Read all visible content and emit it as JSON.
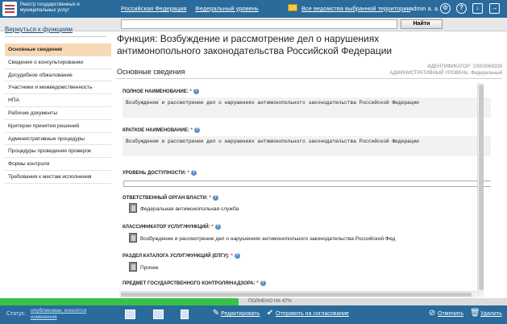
{
  "header": {
    "registry_name": "Реестр государственных и муниципальных услуг",
    "nav": [
      "Российская Федерация",
      "Федеральный уровень",
      "Все ведомства выбранной территории"
    ],
    "user": "admin a. a."
  },
  "search": {
    "value": "",
    "button_label": "Найти"
  },
  "sidebar": {
    "back_link": "Вернуться к функциям",
    "items": [
      "Основные сведения",
      "Сведения о консультировании",
      "Досудебное обжалование",
      "Участники и межведомственность",
      "НПА",
      "Рабочие документы",
      "Критерии принятия решений",
      "Административные процедуры",
      "Процедуры проведения проверок",
      "Формы контроля",
      "Требования к местам исполнения"
    ],
    "active_index": 0
  },
  "main": {
    "title": "Функция: Возбуждение и рассмотрение дел о нарушениях антимонопольного законодательства Российской Федерации",
    "identifier": "ИДЕНТИФИКАТОР: 10000069339",
    "admin_level": "АДМИНИСТРАТИВНЫЙ УРОВЕНЬ: Федеральный",
    "section_title": "Основные сведения",
    "required_mark": "*",
    "help_mark": "?",
    "fields": {
      "full_name_label": "ПОЛНОЕ НАИМЕНОВАНИЕ:",
      "full_name_value": "Возбуждение и рассмотрение дел о нарушениях антимонопольного законодательства Российской Федерации",
      "short_name_label": "КРАТКОЕ НАИМЕНОВАНИЕ:",
      "short_name_value": "Возбуждение и рассмотрение дел о нарушениях антимонопольного законодательства Российской Федерации",
      "access_label": "УРОВЕНЬ ДОСТУПНОСТИ:",
      "access_value": "",
      "authority_label": "ОТВЕТСТВЕННЫЙ ОРГАН ВЛАСТИ:",
      "authority_value": "Федеральная антимонопольная служба",
      "classifier_label": "КЛАССИФИКАТОР УСЛУГ/ФУНКЦИЙ:",
      "classifier_value": "Возбуждение и рассмотрение дел о нарушениях антимонопольного законодательства Российской Фед",
      "catalog_label": "РАЗДЕЛ КАТАЛОГА УСЛУГ/ФУНКЦИЙ (ЕПГУ):",
      "catalog_value": "Прочее",
      "subject_label": "ПРЕДМЕТ ГОСУДАРСТВЕННОГО КОНТРОЛЯ/НАДЗОРА:"
    }
  },
  "progress": {
    "percent": 47,
    "label": "ПОЛНЕНО НА 47%"
  },
  "status": {
    "label": "Статус:",
    "value": "опубликован, вносятся изменения",
    "actions": {
      "edit": "Редактировать",
      "send": "Отправить на согласование",
      "cancel": "Отменить",
      "delete": "Удалить"
    }
  },
  "colors": {
    "header_bg": "#2a6b9c",
    "progress_fill": "#37c14a",
    "active_menu": "#f7d9b5",
    "required": "#d22222"
  }
}
